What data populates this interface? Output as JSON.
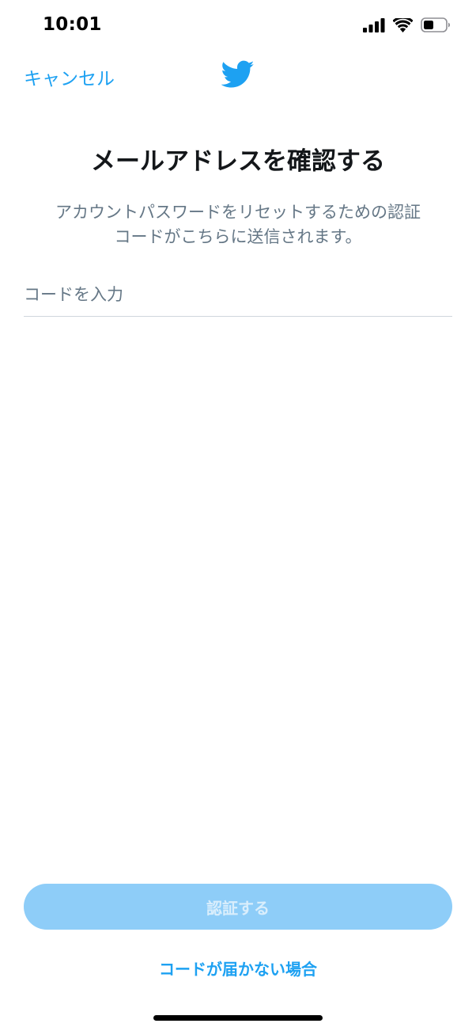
{
  "status_bar": {
    "time": "10:01",
    "icons": [
      "signal-icon",
      "wifi-icon",
      "battery-icon"
    ]
  },
  "nav": {
    "cancel_label": "キャンセル",
    "logo_icon": "twitter-bird-icon",
    "brand_color": "#1da1f2"
  },
  "main": {
    "title": "メールアドレスを確認する",
    "description_line1": "アカウントパスワードをリセットするための認証",
    "description_line2": "コードがこちらに送信されます。",
    "code_input": {
      "placeholder": "コードを入力",
      "value": ""
    }
  },
  "footer": {
    "verify_label": "認証する",
    "verify_button_color": "#8ecdf8",
    "no_code_label": "コードが届かない場合"
  }
}
